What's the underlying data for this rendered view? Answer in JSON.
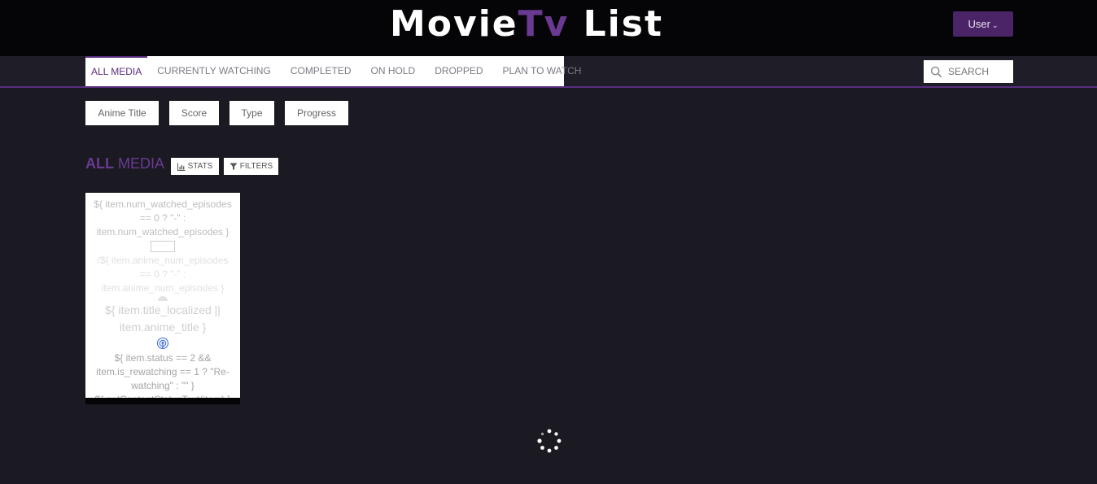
{
  "header": {
    "logo_main": "Movie",
    "logo_accent": "Tv",
    "logo_tail": " List",
    "user_label": "User"
  },
  "nav": {
    "tabs": [
      {
        "label": "ALL MEDIA",
        "active": true
      },
      {
        "label": "CURRENTLY WATCHING",
        "active": false
      },
      {
        "label": "COMPLETED",
        "active": false
      },
      {
        "label": "ON HOLD",
        "active": false
      },
      {
        "label": "DROPPED",
        "active": false
      },
      {
        "label": "PLAN TO WATCH",
        "active": false
      }
    ],
    "search_placeholder": "SEARCH"
  },
  "sort": {
    "buttons": [
      "Anime Title",
      "Score",
      "Type",
      "Progress"
    ]
  },
  "section": {
    "title_strong": "ALL",
    "title_light": "MEDIA",
    "stats_label": "STATS",
    "filters_label": "FILTERS"
  },
  "card": {
    "watched": "${ item.num_watched_episodes == 0 ? \"-\" : item.num_watched_episodes }",
    "total": "/${ item.anime_num_episodes == 0 ? \"-\" : item.anime_num_episodes }",
    "title": "${ item.title_localized || item.anime_title }",
    "status": "${ item.status == 2 && item.is_rewatching == 1 ? \"Re-watching\" : \"\" }",
    "content_status": "${ getContentStatusText(item) }"
  },
  "colors": {
    "accent": "#5b2d80",
    "background": "#1b1a22",
    "topbar": "#050507",
    "user_button": "#4a2466"
  }
}
